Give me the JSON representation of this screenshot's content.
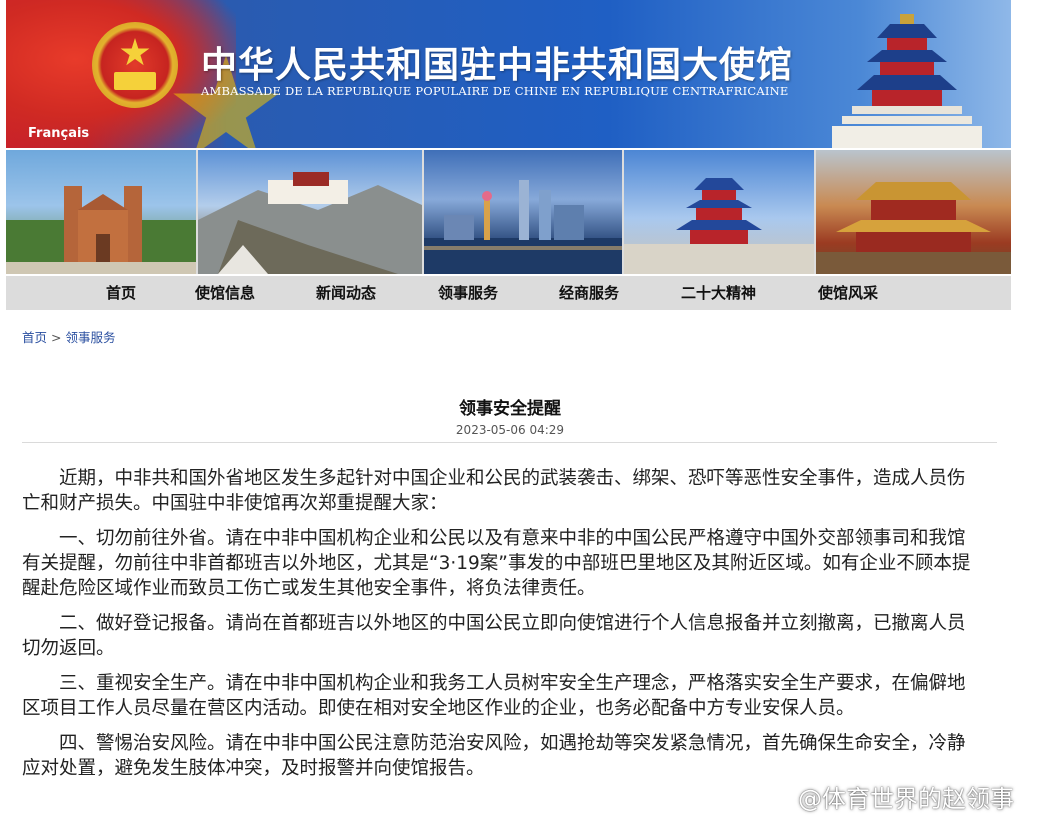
{
  "banner": {
    "title": "中华人民共和国驻中非共和国大使馆",
    "subtitle": "AMBASSADE DE LA REPUBLIQUE POPULAIRE DE CHINE EN REPUBLIQUE CENTRAFRICAINE",
    "language_link": "Français"
  },
  "nav": {
    "items": [
      {
        "label": "首页"
      },
      {
        "label": "使馆信息"
      },
      {
        "label": "新闻动态"
      },
      {
        "label": "领事服务"
      },
      {
        "label": "经商服务"
      },
      {
        "label": "二十大精神"
      },
      {
        "label": "使馆风采"
      }
    ]
  },
  "breadcrumb": {
    "home": "首页",
    "separator": ">",
    "current": "领事服务"
  },
  "article": {
    "title": "领事安全提醒",
    "date": "2023-05-06 04:29",
    "paragraphs": [
      "近期，中非共和国外省地区发生多起针对中国企业和公民的武装袭击、绑架、恐吓等恶性安全事件，造成人员伤亡和财产损失。中国驻中非使馆再次郑重提醒大家：",
      "一、切勿前往外省。请在中非中国机构企业和公民以及有意来中非的中国公民严格遵守中国外交部领事司和我馆有关提醒，勿前往中非首都班吉以外地区，尤其是“3·19案”事发的中部班巴里地区及其附近区域。如有企业不顾本提醒赴危险区域作业而致员工伤亡或发生其他安全事件，将负法律责任。",
      "二、做好登记报备。请尚在首都班吉以外地区的中国公民立即向使馆进行个人信息报备并立刻撤离，已撤离人员切勿返回。",
      "三、重视安全生产。请在中非中国机构企业和我务工人员树牢安全生产理念，严格落实安全生产要求，在偏僻地区项目工作人员尽量在营区内活动。即使在相对安全地区作业的企业，也务必配备中方专业安保人员。",
      "四、警惕治安风险。请在中非中国公民注意防范治安风险，如遇抢劫等突发紧急情况，首先确保生命安全，冷静应对处置，避免发生肢体冲突，及时报警并向使馆报告。"
    ]
  },
  "watermark": {
    "text": "@体育世界的赵领事"
  }
}
